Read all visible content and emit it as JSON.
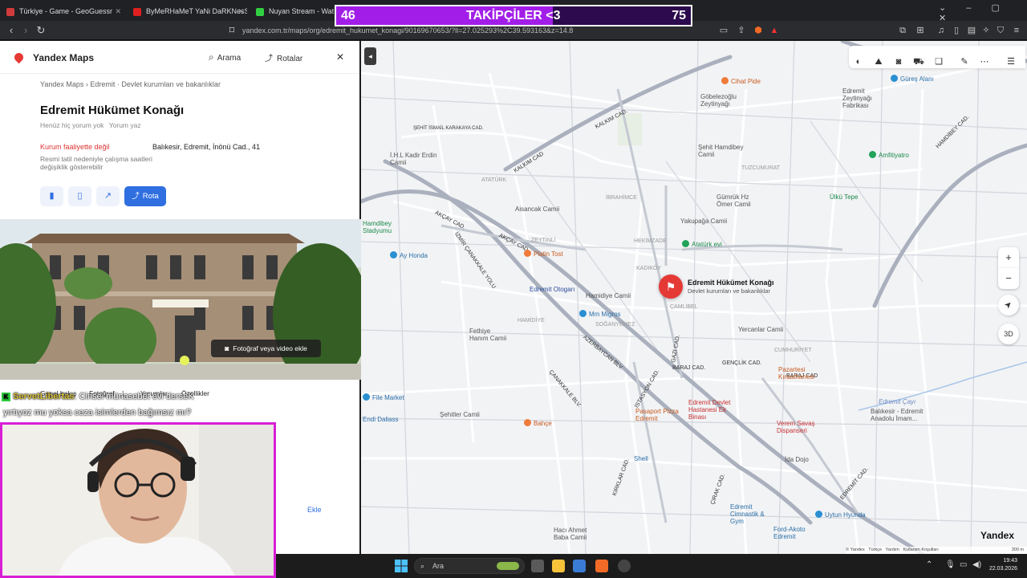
{
  "browser": {
    "tabs": [
      {
        "label": "Türkiye - Game - GeoGuessr",
        "color": "#d23b3b"
      },
      {
        "label": "ByMeRHaMeT YaNi DaRKNesSs",
        "color": "#e02020"
      },
      {
        "label": "Nuyan Stream - Watch Li",
        "color": "#30d040"
      }
    ],
    "url": "yandex.com.tr/maps/org/edremit_hukumet_konagi/90169670653/?ll=27.025293%2C39.593163&z=14.8"
  },
  "overlay": {
    "left_count": "46",
    "label": "TAKİPÇİLER <3",
    "right_count": "75",
    "progress": 0.61
  },
  "sidebar": {
    "app_name": "Yandex Maps",
    "search": "Arama",
    "routes": "Rotalar",
    "close": "✕",
    "breadcrumbs": [
      "Yandex Maps",
      "Edremit",
      "Devlet kurumları ve bakanlıklar"
    ],
    "title": "Edremit Hükümet Konağı",
    "no_reviews": "Henüz hiç yorum yok",
    "write_review": "Yorum yaz",
    "status": "Kurum faaliyette değil",
    "address": "Balıkesir, Edremit, İnönü Cad., 41",
    "holiday_note": "Resmi tatil nedeniyle çalışma saatleri değişiklik gösterebilir",
    "route_button": "Rota",
    "add_photo": "Fotoğraf veya video ekle",
    "tabs": [
      "Genel bakış",
      "Fotoğraf",
      "1",
      "Yorumlar",
      "Özellikler"
    ],
    "add": "Ekle"
  },
  "chat": {
    "user": "ServetLibertas",
    "line1": ": Cinsel münasebet evi derseK",
    "line2": "yırtıyoz mu yoksa ceza isimlerden bağımsız mı?"
  },
  "map": {
    "selected": {
      "name": "Edremit Hükümet Konağı",
      "category": "Devlet kurumları ve bakanlıklar"
    },
    "streets": [
      "ŞEHİT İSMAİL KARAKAYA CAD.",
      "KALKIM CAD.",
      "KALKIM CAD",
      "AKÇAY CAD.",
      "AKÇAY CAD",
      "İZMİR ÇANAKKALE YOLU",
      "ÇANAKKALE BLV.",
      "AZERBAYCAN BLV.",
      "İSTASYON CAD.",
      "HAMDİBEY CAD.",
      "ATATÜRK",
      "TUZCUMURAT",
      "HEKİMZADE",
      "İBRAHİMCE",
      "GAZİ CAD.",
      "BARAJ CAD.",
      "BARAJ CAD",
      "GENÇLİK CAD.",
      "ÇIRAK CAD.",
      "KIRKLAR CAD.",
      "CUMHURİYET",
      "ÇAMLIBEL",
      "KADIKÖY",
      "SOĞANYEMEZ",
      "HAMİDİYE",
      "ZEYTİNLİ",
      "EDREMİT CAD."
    ],
    "pois": [
      {
        "name": "Cihat Pide",
        "color": "#f07b3a"
      },
      {
        "name": "Güreş Alanı",
        "color": "#2a8fd1"
      },
      {
        "name": "Göbelezoğlu Zeytinyağı",
        "color": "#8e8e8e"
      },
      {
        "name": "Edremit Zeytinyağı Fabrikası",
        "color": "#8e8e8e"
      },
      {
        "name": "Şehit Hamdibey Camii",
        "color": "#8e8e8e"
      },
      {
        "name": "Amfitiyatro",
        "color": "#21a35a"
      },
      {
        "name": "İ.H.L Kadir Erdin Camii",
        "color": "#8e8e8e"
      },
      {
        "name": "Gümrük Hz Ömer Camii",
        "color": "#8e8e8e"
      },
      {
        "name": "Ülkü Tepe",
        "color": "#21a35a"
      },
      {
        "name": "Aisancak Camii",
        "color": "#8e8e8e"
      },
      {
        "name": "Yakupağa Camii",
        "color": "#8e8e8e"
      },
      {
        "name": "Hamdibey Stadyumu",
        "color": "#21a35a"
      },
      {
        "name": "Atatürk evi",
        "color": "#21a35a"
      },
      {
        "name": "Ay Honda",
        "color": "#2a8fd1"
      },
      {
        "name": "Platin Tost",
        "color": "#f07b3a"
      },
      {
        "name": "Edremit Otogarı",
        "color": "#2a6bd1"
      },
      {
        "name": "Hamidiye Camii",
        "color": "#8e8e8e"
      },
      {
        "name": "Mm Migros",
        "color": "#2a8fd1"
      },
      {
        "name": "Fethiye Hanım Camii",
        "color": "#8e8e8e"
      },
      {
        "name": "Yercanlar Camii",
        "color": "#8e8e8e"
      },
      {
        "name": "Pazartesi Kıraathanesi",
        "color": "#f07b3a"
      },
      {
        "name": "File Market",
        "color": "#2a8fd1"
      },
      {
        "name": "Endi Daliass",
        "color": "#2a8fd1"
      },
      {
        "name": "Şehitler Camii",
        "color": "#8e8e8e"
      },
      {
        "name": "Bahçe",
        "color": "#f07b3a"
      },
      {
        "name": "Pasaport Pizza Edremit",
        "color": "#f07b3a"
      },
      {
        "name": "Edremit Devlet Hastanesi Ek Binası",
        "color": "#d33b3b"
      },
      {
        "name": "Verem Savaş Dispanseri",
        "color": "#d33b3b"
      },
      {
        "name": "Balıkesir - Edremit Anadolu İmam...",
        "color": "#8e8e8e"
      },
      {
        "name": "Shell",
        "color": "#2a8fd1"
      },
      {
        "name": "İda Dojo",
        "color": "#8e8e8e"
      },
      {
        "name": "Edremit Cimnastik & Gym",
        "color": "#2a8fd1"
      },
      {
        "name": "Uytun Hyunda",
        "color": "#2a8fd1"
      },
      {
        "name": "Ford-Akoto Edremit",
        "color": "#2a8fd1"
      },
      {
        "name": "Hacı Ahmet Baba Camii",
        "color": "#8e8e8e"
      },
      {
        "name": "Edremit Çayı",
        "color": "#6c8cbf"
      }
    ],
    "controls": {
      "zoom_in": "+",
      "zoom_out": "−",
      "locate": "➤",
      "three_d": "3D"
    },
    "brand": "Yandex",
    "footer": [
      "© Yandex",
      "Türkçe",
      "Yardım",
      "Kullanım Koşulları",
      "300 m"
    ]
  },
  "taskbar": {
    "search": "Ara",
    "time": "19:43",
    "date": "22.03.2026"
  }
}
